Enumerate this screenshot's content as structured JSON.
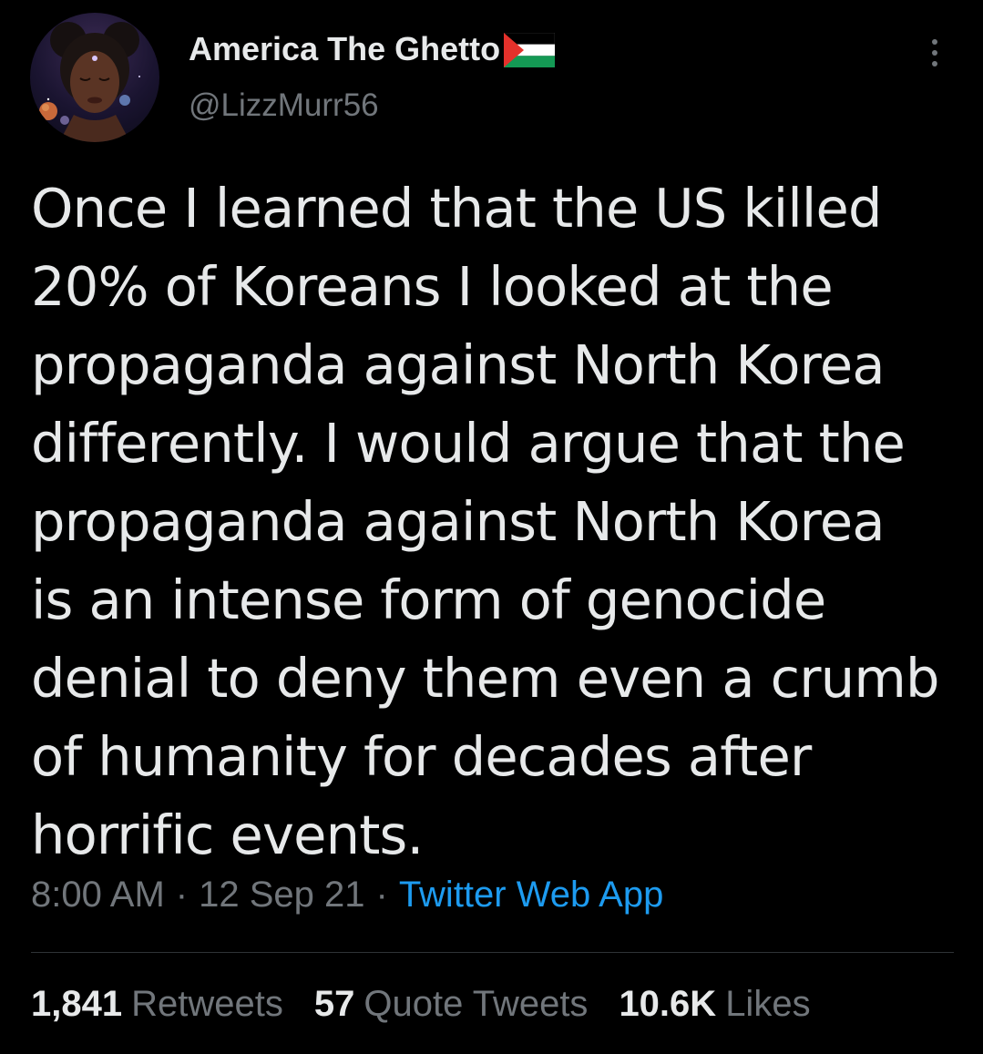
{
  "author": {
    "display_name": "America The Ghetto",
    "flag_icon": "palestine-flag-icon",
    "handle": "@LizzMurr56",
    "avatar_icon": "profile-avatar"
  },
  "tweet": {
    "text": "Once I learned that the US killed\n20% of Koreans I looked at the\npropaganda  against North Korea\ndifferently. I would argue that the\npropaganda against North Korea\nis an intense form of genocide\ndenial to deny them even a crumb\nof humanity for decades after\nhorrific events.",
    "time": "8:00 AM",
    "separator": "·",
    "date": "12 Sep 21",
    "source": "Twitter Web App"
  },
  "stats": {
    "retweets_count": "1,841",
    "retweets_label": "Retweets",
    "quotes_count": "57",
    "quotes_label": "Quote Tweets",
    "likes_count": "10.6K",
    "likes_label": "Likes"
  },
  "colors": {
    "background": "#000000",
    "text_primary": "#e7e9ea",
    "text_secondary": "#71767b",
    "link": "#1d9bf0",
    "divider": "#2f3336"
  }
}
